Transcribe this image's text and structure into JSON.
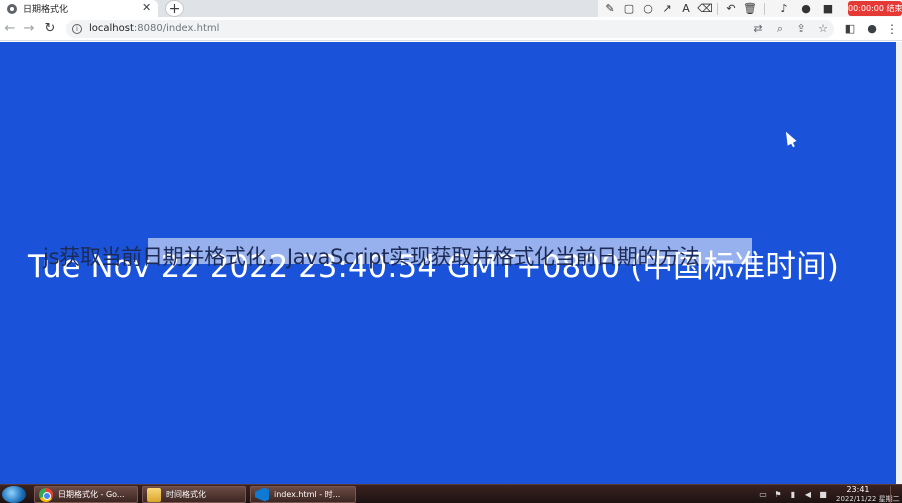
{
  "browser": {
    "tab": {
      "title": "日期格式化",
      "close_glyph": "✕"
    },
    "new_tab_glyph": "+",
    "nav": {
      "back": "←",
      "forward": "→",
      "reload": "↻"
    },
    "address_bar": {
      "host": "localhost",
      "rest": ":8080/index.html"
    },
    "omnibox_icons": [
      "translate-icon",
      "zoom-icon",
      "share-icon",
      "bookmark-star-icon"
    ],
    "toolbar_icons": [
      "sidebar-icon",
      "profile-icon",
      "menu-icon"
    ]
  },
  "recorder": {
    "tools": [
      "pen-icon",
      "rectangle-icon",
      "circle-icon",
      "arrow-icon",
      "text-icon",
      "highlighter-icon",
      "undo-icon",
      "trash-icon",
      "speaker-icon",
      "microphone-icon",
      "camera-icon"
    ],
    "timer_label": "00:00:00 结束"
  },
  "page": {
    "background_color": "#1a53d9",
    "date_text": "Tue Nov 22 2022 23:40:54 GMT+0800 (中国标准时间)",
    "caption": "js获取当前日期并格式化，JavaScript实现获取并格式化当前日期的方法"
  },
  "taskbar": {
    "items": [
      {
        "label": "日期格式化 - Go...",
        "icon": "chrome-icon"
      },
      {
        "label": "时间格式化",
        "icon": "folder-icon"
      },
      {
        "label": "index.html - 时...",
        "icon": "vscode-icon"
      }
    ],
    "clock": {
      "time": "23:41",
      "date": "2022/11/22 星期二"
    }
  }
}
